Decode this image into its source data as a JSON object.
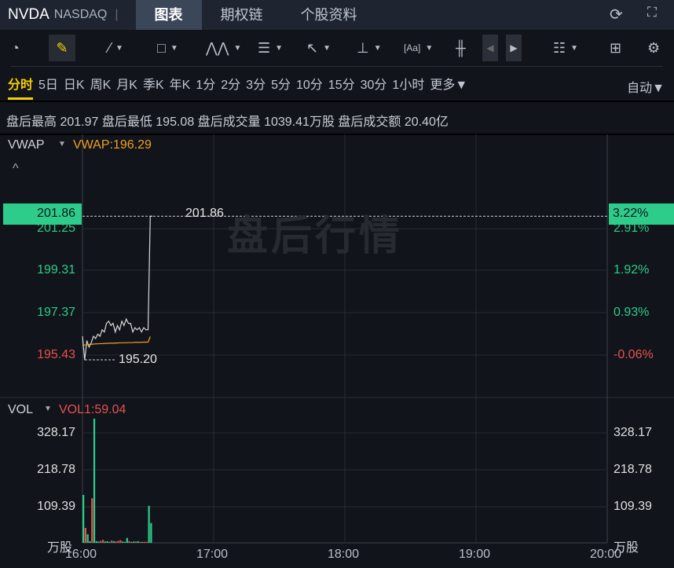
{
  "header": {
    "symbol": "NVDA",
    "exchange": "NASDAQ",
    "tabs": [
      "图表",
      "期权链",
      "个股资料"
    ],
    "active_tab": "图表"
  },
  "toolbar": {
    "icons": [
      "gauge-icon",
      "pencil-icon",
      "line-icon",
      "rectangle-icon",
      "pattern-icon",
      "fibonacci-icon",
      "arrow-icon",
      "price-range-icon",
      "text-icon",
      "candlestick-icon",
      "prev-icon",
      "next-icon",
      "layout-list-icon",
      "grid-icon",
      "gear-icon"
    ]
  },
  "periods": {
    "items": [
      "分时",
      "5日",
      "日K",
      "周K",
      "月K",
      "季K",
      "年K",
      "1分",
      "2分",
      "3分",
      "5分",
      "10分",
      "15分",
      "30分",
      "1小时",
      "更多▼"
    ],
    "active": "分时",
    "auto": "自动▼"
  },
  "stats": {
    "text": "盘后最高 201.97 盘后最低 195.08 盘后成交量 1039.41万股 盘后成交额 20.40亿"
  },
  "price_pane": {
    "indicator": "VWAP",
    "vwap_label": "VWAP:196.29",
    "current_price": "201.86",
    "current_pct": "3.22%",
    "low_label": "195.20",
    "watermark": "盘后行情",
    "y_labels": [
      "201.25",
      "199.31",
      "197.37",
      "195.43"
    ],
    "pct_labels": [
      "2.91%",
      "1.92%",
      "0.93%",
      "-0.06%"
    ]
  },
  "vol_pane": {
    "indicator": "VOL",
    "vol_label": "VOL1:59.04",
    "y_labels": [
      "328.17",
      "218.78",
      "109.39"
    ],
    "unit": "万股"
  },
  "x_labels": [
    "16:00",
    "17:00",
    "18:00",
    "19:00",
    "20:00"
  ],
  "colors": {
    "up": "#2ecc8a",
    "down": "#e8524f",
    "vwap": "#f0a020",
    "active": "#f5d000"
  },
  "chart_data": {
    "type": "line",
    "x_range_minutes_after_1600": [
      0,
      240
    ],
    "price_range": [
      194.9,
      202.9
    ],
    "price": [
      196.3,
      195.2,
      196.1,
      195.8,
      196.0,
      196.3,
      196.2,
      196.4,
      196.3,
      196.6,
      196.5,
      196.9,
      197.0,
      196.8,
      196.9,
      196.5,
      196.8,
      196.6,
      197.0,
      196.8,
      197.1,
      196.9,
      196.9,
      196.5,
      196.7,
      196.6,
      196.7,
      196.5,
      196.7,
      196.6,
      196.6,
      201.86,
      201.86
    ],
    "vwap": [
      195.9,
      195.9,
      195.9,
      195.92,
      195.93,
      195.94,
      195.95,
      195.95,
      195.96,
      195.96,
      195.97,
      195.97,
      195.98,
      195.98,
      195.98,
      195.99,
      195.99,
      196.0,
      196.0,
      196.0,
      196.0,
      196.01,
      196.01,
      196.01,
      196.02,
      196.02,
      196.02,
      196.02,
      196.03,
      196.03,
      196.03,
      196.29
    ],
    "volume": [
      145,
      45,
      26,
      5,
      135,
      376,
      5,
      4,
      6,
      9,
      4,
      5,
      3,
      7,
      5,
      4,
      6,
      8,
      4,
      3,
      15,
      5,
      3,
      4,
      4,
      5,
      3,
      3,
      3,
      3,
      112,
      60
    ],
    "volume_up": [
      1,
      0,
      1,
      1,
      0,
      1,
      1,
      1,
      0,
      0,
      1,
      1,
      1,
      0,
      1,
      0,
      0,
      0,
      1,
      1,
      1,
      0,
      1,
      1,
      0,
      1,
      0,
      1,
      0,
      0,
      1,
      1
    ],
    "volume_range": [
      0,
      380
    ]
  }
}
